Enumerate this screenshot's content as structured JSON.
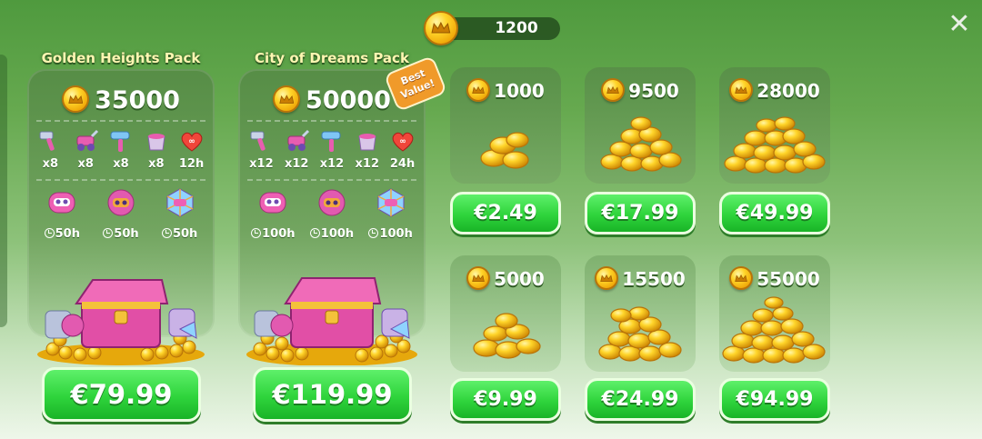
{
  "balance": {
    "amount": "1200"
  },
  "close": {
    "icon": "close-icon"
  },
  "colors": {
    "button_green": "#2fd43c",
    "title_yellow": "#fff6b2",
    "badge_orange": "#f09a2a",
    "coin_gold": "#ffd52a"
  },
  "packs": [
    {
      "title": "Golden Heights Pack",
      "coins": "35000",
      "items": [
        {
          "icon": "hammer-icon",
          "label": "x8"
        },
        {
          "icon": "lawnmower-icon",
          "label": "x8"
        },
        {
          "icon": "paint-roller-icon",
          "label": "x8"
        },
        {
          "icon": "paint-bucket-icon",
          "label": "x8"
        },
        {
          "icon": "heart-icon",
          "label": "12h"
        }
      ],
      "tickets": [
        {
          "icon": "mask-ticket-icon",
          "label": "50h"
        },
        {
          "icon": "owl-ticket-icon",
          "label": "50h"
        },
        {
          "icon": "diamond-ticket-icon",
          "label": "50h"
        }
      ],
      "price": "€79.99"
    },
    {
      "title": "City of Dreams Pack",
      "badge": "Best Value!",
      "coins": "50000",
      "items": [
        {
          "icon": "hammer-icon",
          "label": "x12"
        },
        {
          "icon": "lawnmower-icon",
          "label": "x12"
        },
        {
          "icon": "paint-roller-icon",
          "label": "x12"
        },
        {
          "icon": "paint-bucket-icon",
          "label": "x12"
        },
        {
          "icon": "heart-icon",
          "label": "24h"
        }
      ],
      "tickets": [
        {
          "icon": "mask-ticket-icon",
          "label": "100h"
        },
        {
          "icon": "owl-ticket-icon",
          "label": "100h"
        },
        {
          "icon": "diamond-ticket-icon",
          "label": "100h"
        }
      ],
      "price": "€119.99"
    }
  ],
  "coin_offers": [
    {
      "coins": "1000",
      "price": "€2.49"
    },
    {
      "coins": "9500",
      "price": "€17.99"
    },
    {
      "coins": "28000",
      "price": "€49.99"
    },
    {
      "coins": "5000",
      "price": "€9.99"
    },
    {
      "coins": "15500",
      "price": "€24.99"
    },
    {
      "coins": "55000",
      "price": "€94.99"
    }
  ]
}
